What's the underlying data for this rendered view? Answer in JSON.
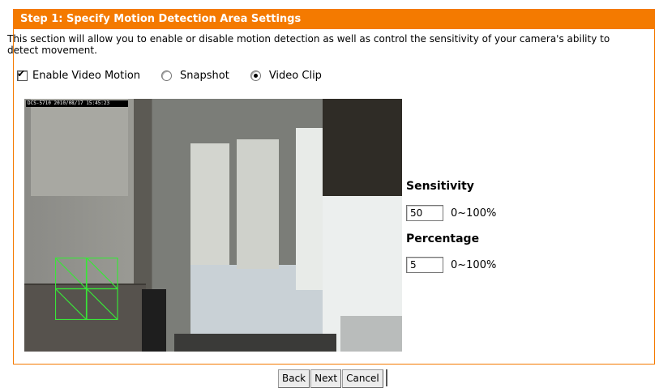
{
  "header": {
    "title": "Step 1: Specify Motion Detection Area Settings"
  },
  "description": "This section will allow you to enable or disable motion detection as well as control the sensitivity of your camera's ability to detect movement.",
  "options": {
    "enable_label": "Enable Video Motion",
    "enable_checked": true,
    "snapshot_label": "Snapshot",
    "snapshot_selected": false,
    "videoclip_label": "Video Clip",
    "videoclip_selected": true
  },
  "video": {
    "timestamp": "DCS-5710 2010/08/17 15:45:23"
  },
  "sensitivity": {
    "label": "Sensitivity",
    "value": "50",
    "range": "0~100%"
  },
  "percentage": {
    "label": "Percentage",
    "value": "5",
    "range": "0~100%"
  },
  "buttons": {
    "back": "Back",
    "next": "Next",
    "cancel": "Cancel"
  },
  "colors": {
    "header_bg": "#f47a00",
    "grid_line": "#39e639"
  }
}
